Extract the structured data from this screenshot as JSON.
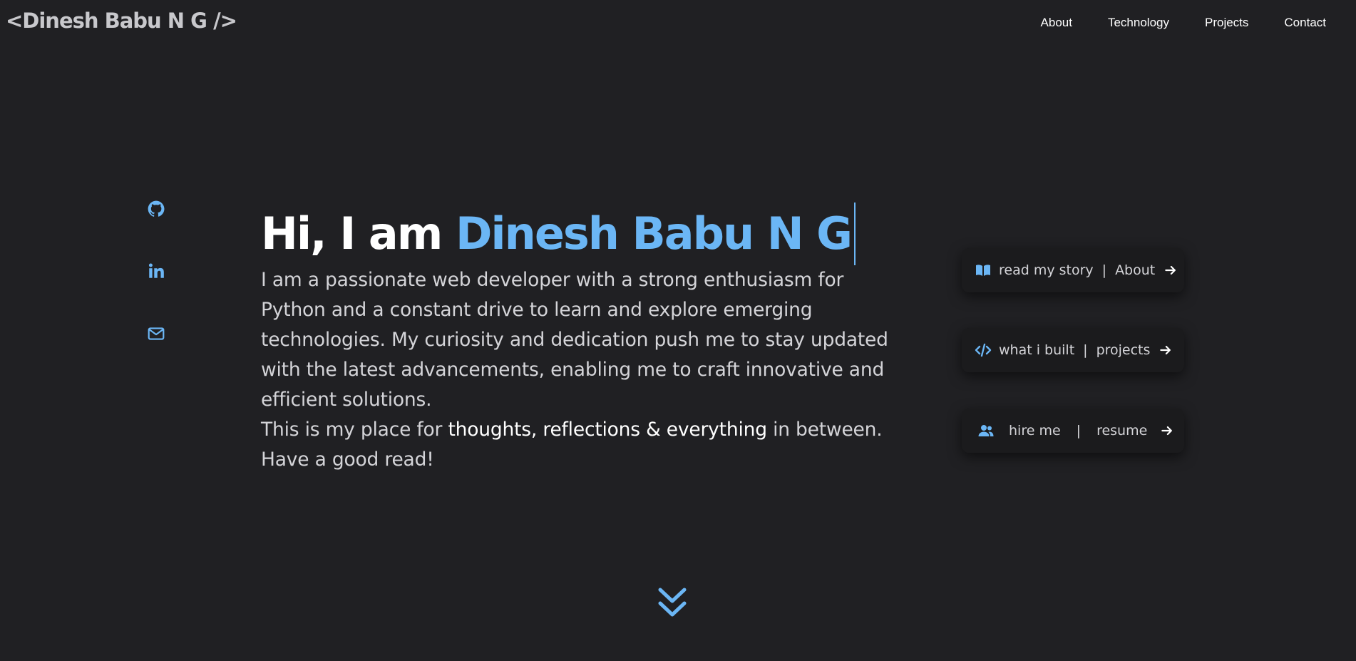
{
  "header": {
    "logo": "<Dinesh Babu N G />",
    "nav": [
      "About",
      "Technology",
      "Projects",
      "Contact"
    ]
  },
  "social": {
    "icons": [
      "github-icon",
      "linkedin-icon",
      "mail-icon"
    ]
  },
  "hero": {
    "greeting": "Hi, I am ",
    "name": "Dinesh Babu N G",
    "intro": "I am a passionate web developer with a strong enthusiasm for Python and a constant drive to learn and explore emerging technologies. My curiosity and dedication push me to stay updated with the latest advancements, enabling me to craft innovative and efficient solutions.",
    "place_prefix": "This is my place for ",
    "place_highlight": "thoughts, reflections & everything",
    "place_suffix": " in between. Have a good read!"
  },
  "cards": [
    {
      "left": "read my story",
      "sep": "|",
      "right": "About",
      "icon": "book-icon"
    },
    {
      "left": "what i built",
      "sep": "|",
      "right": "projects",
      "icon": "code-icon"
    },
    {
      "left": "hire me",
      "sep": "|",
      "right": "resume",
      "icon": "users-icon"
    }
  ],
  "colors": {
    "background": "#202023",
    "accent": "#6bb6f5",
    "highlight": "#0a8ff0",
    "card": "#1b1b1d"
  }
}
